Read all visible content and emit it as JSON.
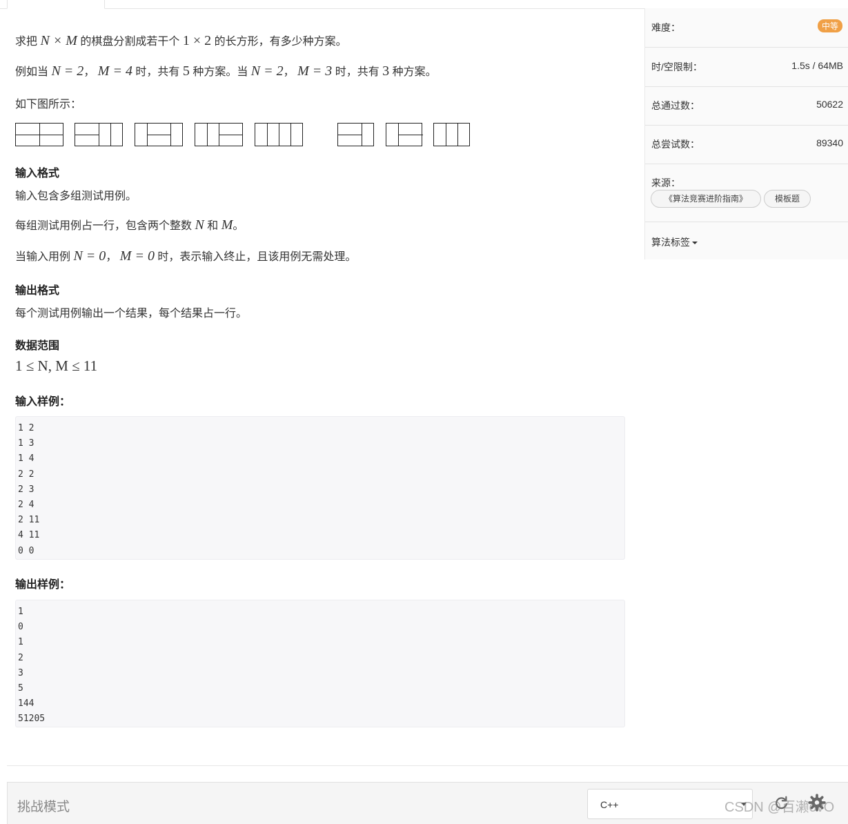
{
  "problem": {
    "intro_prefix": "求把",
    "intro_math1": "N × M",
    "intro_mid": "的棋盘分割成若干个",
    "intro_math2": "1 × 2",
    "intro_suffix": "的长方形，有多少种方案。",
    "example_a": "例如当",
    "example_m1": "N = 2",
    "example_sep1": "，",
    "example_m2": "M = 4",
    "example_b": "时，共有",
    "example_m3": "5",
    "example_c": "种方案。当",
    "example_m4": "N = 2",
    "example_sep2": "，",
    "example_m5": "M = 3",
    "example_d": "时，共有",
    "example_m6": "3",
    "example_e": "种方案。",
    "figure_caption": "如下图所示：",
    "input_format_heading": "输入格式",
    "input_line1": "输入包含多组测试用例。",
    "input_line2_a": "每组测试用例占一行，包含两个整数",
    "input_line2_m1": "N",
    "input_line2_b": "和",
    "input_line2_m2": "M",
    "input_line2_c": "。",
    "input_line3_a": "当输入用例",
    "input_line3_m1": "N = 0",
    "input_line3_sep": "，",
    "input_line3_m2": "M = 0",
    "input_line3_b": "时，表示输入终止，且该用例无需处理。",
    "output_format_heading": "输出格式",
    "output_line1": "每个测试用例输出一个结果，每个结果占一行。",
    "range_heading": "数据范围",
    "range_formula": "1 ≤ N, M ≤ 11",
    "sample_input_heading": "输入样例：",
    "sample_input": [
      "1 2",
      "1 3",
      "1 4",
      "2 2",
      "2 3",
      "2 4",
      "2 11",
      "4 11",
      "0 0"
    ],
    "sample_output_heading": "输出样例：",
    "sample_output": [
      "1",
      "0",
      "1",
      "2",
      "3",
      "5",
      "144",
      "51205"
    ]
  },
  "sidebar": {
    "difficulty_label": "难度：",
    "difficulty_value": "中等",
    "difficulty_color": "#f0a046",
    "limit_label": "时/空限制：",
    "limit_value": "1.5s / 64MB",
    "passed_label": "总通过数：",
    "passed_value": "50622",
    "tried_label": "总尝试数：",
    "tried_value": "89340",
    "source_label": "来源：",
    "source_tags": [
      "《算法竞赛进阶指南》",
      "模板题"
    ],
    "algo_tags_label": "算法标签"
  },
  "bottom": {
    "challenge_mode": "挑战模式",
    "language": "C++"
  },
  "watermark": "CSDN @百濑ovO"
}
